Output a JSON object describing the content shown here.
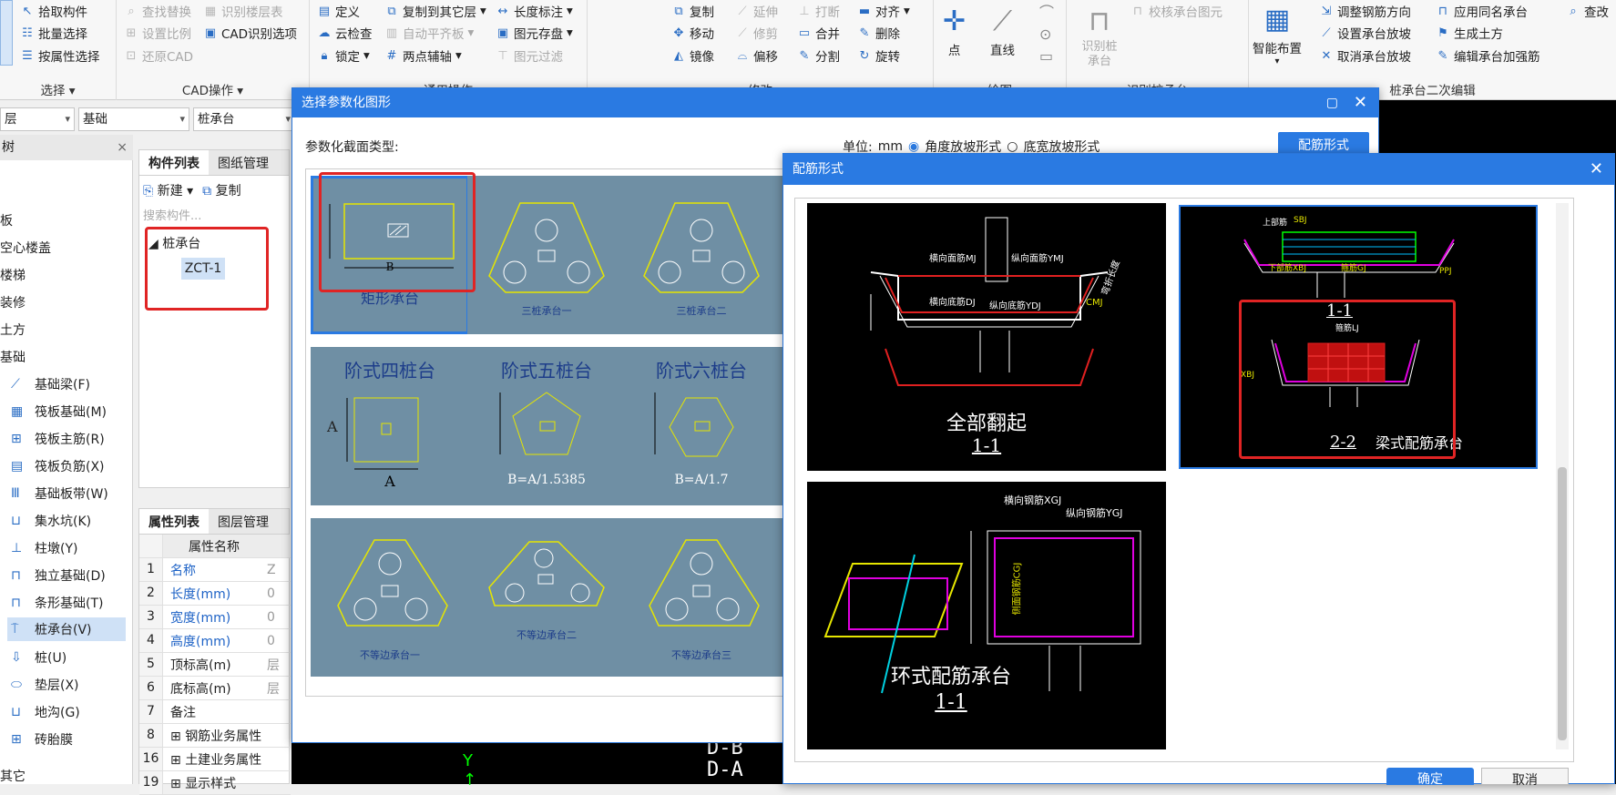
{
  "ribbon": {
    "col1": [
      "拾取构件",
      "批量选择",
      "按属性选择"
    ],
    "select_title": "选择",
    "col2": [
      "查找替换",
      "设置比例",
      "还原CAD"
    ],
    "col3": [
      "识别楼层表",
      "CAD识别选项"
    ],
    "cad_title": "CAD操作",
    "col4": [
      "定义",
      "云检查",
      "锁定"
    ],
    "col5": [
      "复制到其它层",
      "自动平齐板",
      "两点辅轴"
    ],
    "col6": [
      "长度标注",
      "图元存盘",
      "图元过滤"
    ],
    "general_title": "通用操作",
    "col7": [
      "复制",
      "移动",
      "镜像"
    ],
    "col8": [
      "延伸",
      "修剪",
      "偏移"
    ],
    "col9": [
      "打断",
      "合并",
      "分割"
    ],
    "col10": [
      "对齐",
      "删除",
      "旋转"
    ],
    "modify_title": "修改",
    "draw_point": "点",
    "draw_line": "直线",
    "draw_title": "绘图",
    "identify_label": "识别桩承台",
    "identify_check": "校核承台图元",
    "identify_title": "识别桩承台",
    "smart_layout": "智能布置",
    "col11": [
      "调整钢筋方向",
      "设置承台放坡",
      "取消承台放坡"
    ],
    "col12": [
      "应用同名承台",
      "生成土方",
      "编辑承台加强筋"
    ],
    "col13": "查改",
    "edit2_title": "桩承台二次编辑"
  },
  "selectors": {
    "layer": "层",
    "type": "基础",
    "sub": "桩承台"
  },
  "tree": {
    "header": "树",
    "items_plain": [
      "板",
      "空心楼盖",
      "楼梯",
      "装修",
      "土方",
      "基础"
    ],
    "items": [
      "基础梁(F)",
      "筏板基础(M)",
      "筏板主筋(R)",
      "筏板负筋(X)",
      "基础板带(W)",
      "集水坑(K)",
      "柱墩(Y)",
      "独立基础(D)",
      "条形基础(T)",
      "桩承台(V)",
      "桩(U)",
      "垫层(X)",
      "地沟(G)",
      "砖胎膜"
    ],
    "other": "其它"
  },
  "component_panel": {
    "tab1": "构件列表",
    "tab2": "图纸管理",
    "new_btn": "新建",
    "copy_btn": "复制",
    "search_placeholder": "搜索构件...",
    "group": "桩承台",
    "item": "ZCT-1"
  },
  "property_panel": {
    "tab1": "属性列表",
    "tab2": "图层管理",
    "col_name": "属性名称",
    "rows": [
      {
        "n": "1",
        "name": "名称",
        "val": "Z"
      },
      {
        "n": "2",
        "name": "长度(mm)",
        "val": "0"
      },
      {
        "n": "3",
        "name": "宽度(mm)",
        "val": "0"
      },
      {
        "n": "4",
        "name": "高度(mm)",
        "val": "0"
      },
      {
        "n": "5",
        "name": "顶标高(m)",
        "val": "层"
      },
      {
        "n": "6",
        "name": "底标高(m)",
        "val": "层"
      },
      {
        "n": "7",
        "name": "备注",
        "val": ""
      },
      {
        "n": "8",
        "name": "钢筋业务属性",
        "val": ""
      },
      {
        "n": "16",
        "name": "土建业务属性",
        "val": ""
      },
      {
        "n": "19",
        "name": "显示样式",
        "val": ""
      }
    ]
  },
  "param_dialog": {
    "title": "选择参数化图形",
    "section_type": "参数化截面类型:",
    "unit_label": "单位:",
    "unit": "mm",
    "opt_angle": "角度放坡形式",
    "opt_width": "底宽放坡形式",
    "rebar_btn": "配筋形式",
    "tiles": [
      "矩形承台",
      "三桩承台一",
      "三桩承台二",
      "阶式四桩台",
      "阶式五桩台",
      "阶式六桩台",
      "不等边承台一",
      "不等边承台二",
      "不等边承台三"
    ],
    "tile_labels": {
      "b": "B",
      "a": "A",
      "b5": "B=A/1.5385",
      "b6": "B=A/1.7"
    }
  },
  "rebar_dialog": {
    "title": "配筋形式",
    "opt1_title": "全部翻起",
    "opt1_sub": "1-1",
    "opt1_labels": [
      "横向面筋MJ",
      "纵向面筋YMJ",
      "横向底筋DJ",
      "纵向底筋YDJ",
      "CMJ",
      "弯折长度"
    ],
    "opt2_title": "梁式配筋承台",
    "opt2_sub1": "1-1",
    "opt2_sub2": "2-2",
    "opt2_labels": [
      "上部筋",
      "SBJ",
      "下部筋XBJ",
      "侧面筋CMJ",
      "箍筋GJ",
      "PPJ",
      "箍筋LJ",
      "XBJ"
    ],
    "opt3_title": "环式配筋承台",
    "opt3_sub": "1-1",
    "opt3_labels": [
      "横向钢筋XGJ",
      "纵向钢筋YGJ",
      "侧面钢筋CGJ"
    ],
    "ok": "确定",
    "cancel": "取消"
  },
  "canvas_labels": [
    "D-B",
    "D-A"
  ]
}
